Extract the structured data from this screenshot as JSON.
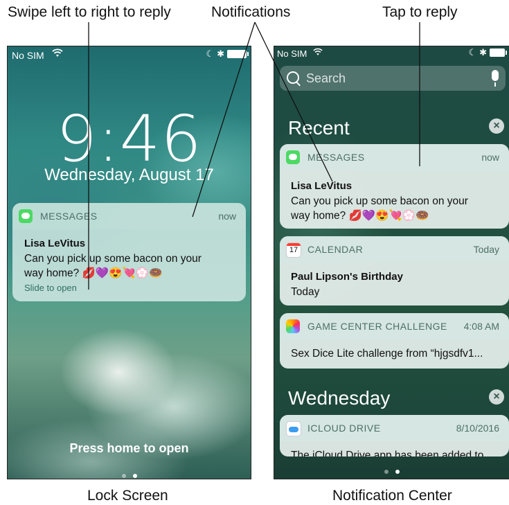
{
  "callouts": {
    "swipe": "Swipe left to right to reply",
    "notifications": "Notifications",
    "tap": "Tap to reply"
  },
  "captions": {
    "lock": "Lock Screen",
    "nc": "Notification Center"
  },
  "lock_screen": {
    "status": {
      "carrier": "No SIM",
      "wifi": "wifi-icon",
      "moon": "moon-icon",
      "bluetooth": "bluetooth-icon",
      "battery": "battery-icon"
    },
    "time": "9:46",
    "date": "Wednesday, August 17",
    "notification": {
      "app": "MESSAGES",
      "time": "now",
      "sender": "Lisa LeVitus",
      "body_line1": "Can you pick up some bacon on your",
      "body_line2": "way home? 💋💜😍💘💮🍩",
      "action": "Slide to open"
    },
    "press_home": "Press home to open",
    "page_dots": 2,
    "active_dot": 1
  },
  "notification_center": {
    "status": {
      "carrier": "No SIM",
      "wifi": "wifi-icon",
      "moon": "moon-icon",
      "bluetooth": "bluetooth-icon",
      "battery": "battery-icon"
    },
    "search_placeholder": "Search",
    "sections": [
      {
        "title": "Recent"
      },
      {
        "title": "Wednesday"
      }
    ],
    "cards": [
      {
        "app": "MESSAGES",
        "time": "now",
        "sender": "Lisa LeVitus",
        "body_line1": "Can you pick up some bacon on your",
        "body_line2": "way home? 💋💜😍💘💮🍩"
      },
      {
        "app": "CALENDAR",
        "time": "Today",
        "icon_text": "17",
        "sender": "Paul Lipson's Birthday",
        "body_line1": "Today"
      },
      {
        "app": "GAME CENTER CHALLENGE",
        "time": "4:08 AM",
        "body_line1": "Sex Dice Lite challenge from “hjgsdfv1..."
      },
      {
        "app": "ICLOUD DRIVE",
        "time": "8/10/2016",
        "body_line1": "The iCloud Drive app has been added to"
      }
    ],
    "page_dots": 2,
    "active_dot": 1
  }
}
